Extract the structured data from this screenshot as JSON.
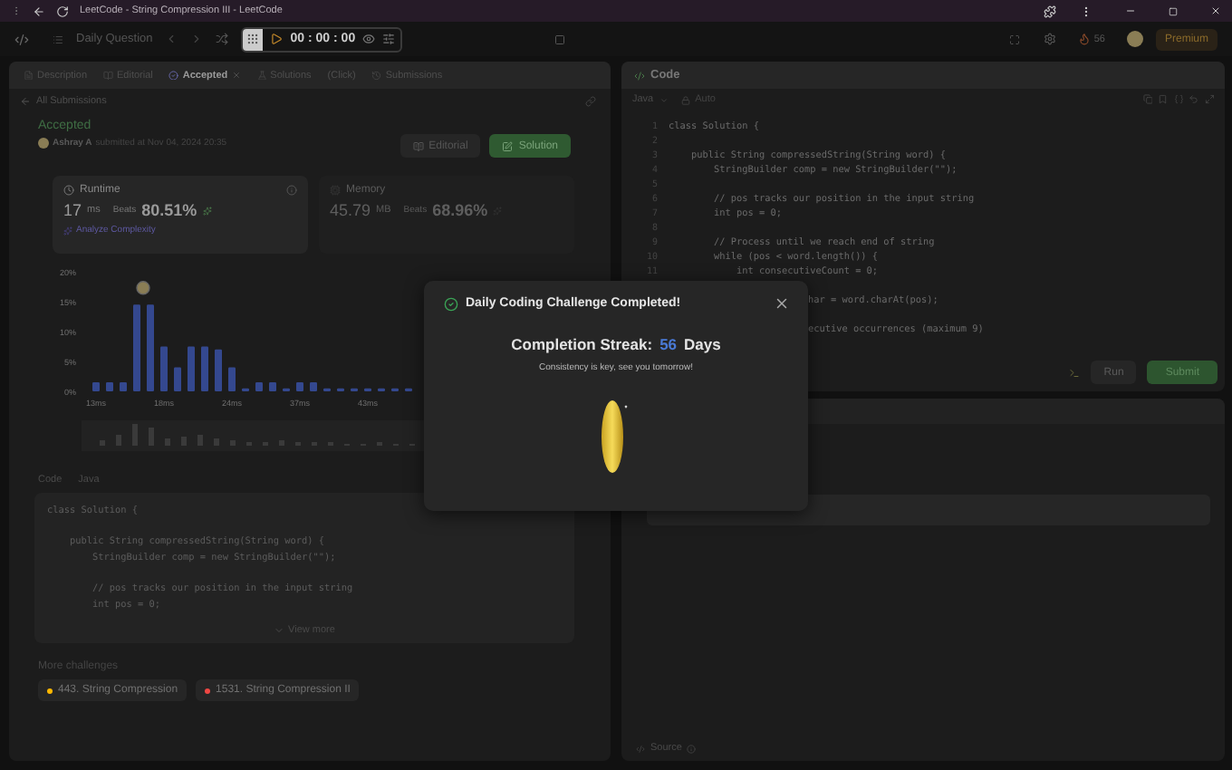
{
  "window": {
    "title": "LeetCode - String Compression III - LeetCode"
  },
  "toolbar": {
    "daily_label": "Daily Question",
    "timer": "00 : 00 : 00",
    "streak_count": "56",
    "premium": "Premium"
  },
  "left_panel": {
    "tabs": [
      {
        "label": "Description",
        "selected": false,
        "closable": false
      },
      {
        "label": "Editorial",
        "selected": false,
        "closable": false
      },
      {
        "label": "Accepted",
        "selected": true,
        "closable": true
      },
      {
        "label": "Solutions",
        "selected": false,
        "closable": false
      },
      {
        "label": "(Click)",
        "selected": false,
        "closable": false
      },
      {
        "label": "Submissions",
        "selected": false,
        "closable": false
      }
    ],
    "back_link": "All Submissions",
    "submission": {
      "status": "Accepted",
      "author": "Ashray A",
      "submitted": "submitted at Nov 04, 2024 20:35",
      "buttons": [
        {
          "label": "Editorial",
          "kind": "plain"
        },
        {
          "label": "Solution",
          "kind": "primary"
        }
      ]
    },
    "metrics": [
      {
        "title": "Runtime",
        "value": "17",
        "unit": "ms",
        "beats_label": "Beats",
        "beats": "80.51%",
        "selected": true,
        "link": "Analyze Complexity"
      },
      {
        "title": "Memory",
        "value": "45.79",
        "unit": "MB",
        "beats_label": "Beats",
        "beats": "68.96%",
        "selected": false
      }
    ],
    "chart_data": {
      "type": "bar",
      "categories": [
        "13ms",
        null,
        null,
        null,
        null,
        "18ms",
        null,
        null,
        null,
        null,
        "24ms",
        null,
        null,
        null,
        null,
        "37ms",
        null,
        null,
        null,
        null,
        "43ms",
        null,
        null,
        null
      ],
      "values": [
        1.5,
        1.5,
        1.5,
        14.5,
        14.5,
        7.5,
        4,
        7.5,
        7.5,
        7,
        4,
        0.5,
        1.5,
        1.5,
        0.5,
        1.5,
        1.5,
        0.5,
        0.5,
        0.5,
        0.5,
        0.5,
        0.5,
        0.5
      ],
      "ylim": [
        0,
        20
      ],
      "yticks": [
        {
          "value": 0,
          "label": "0%"
        },
        {
          "value": 5,
          "label": "5%"
        },
        {
          "value": 10,
          "label": "10%"
        },
        {
          "value": 15,
          "label": "15%"
        },
        {
          "value": 20,
          "label": "20%"
        }
      ]
    },
    "code": {
      "label": "Code",
      "language": "Java",
      "lines": [
        {
          "kind": "code",
          "text": "class Solution {"
        },
        {
          "kind": "blank"
        },
        {
          "kind": "code",
          "text": "    public String compressedString(String word) {"
        },
        {
          "kind": "code",
          "text": "        StringBuilder comp = new StringBuilder(\"\");"
        },
        {
          "kind": "blank"
        },
        {
          "kind": "code",
          "text": "        // pos tracks our position in the input string"
        },
        {
          "kind": "code",
          "text": "        int pos = 0;"
        }
      ],
      "view_more": "View more"
    },
    "more_challenges": {
      "title": "More challenges",
      "items": [
        {
          "label": "443. String Compression",
          "color": "#ffb800"
        },
        {
          "label": "1531. String Compression II",
          "color": "#ef4743"
        }
      ]
    }
  },
  "code_panel": {
    "title": "Code",
    "language": "Java",
    "mode": "Auto",
    "lines": [
      {
        "number": "1",
        "text": "class Solution {"
      },
      {
        "number": "2"
      },
      {
        "number": "3",
        "text": "    public String compressedString(String word) {"
      },
      {
        "number": "4",
        "text": "        StringBuilder comp = new StringBuilder(\"\");"
      },
      {
        "number": "5"
      },
      {
        "number": "6",
        "text": "        // pos tracks our position in the input string"
      },
      {
        "number": "7",
        "text": "        int pos = 0;"
      },
      {
        "number": "8"
      },
      {
        "number": "9",
        "text": "        // Process until we reach end of string"
      },
      {
        "number": "10",
        "text": "        while (pos < word.length()) {"
      },
      {
        "number": "11",
        "text": "            int consecutiveCount = 0;"
      }
    ],
    "partial_lines": [
      "har = word.charAt(pos);",
      "ecutive occurrences (maximum 9)"
    ],
    "buttons": [
      {
        "label": "Run",
        "kind": "plain"
      },
      {
        "label": "Submit",
        "kind": "primary"
      }
    ]
  },
  "console": {
    "source": "Source"
  },
  "modal": {
    "title": "Daily Coding Challenge Completed!",
    "streak_label": "Completion Streak:",
    "streak_value": "56",
    "streak_unit": "Days",
    "message": "Consistency is key, see you tomorrow!"
  }
}
